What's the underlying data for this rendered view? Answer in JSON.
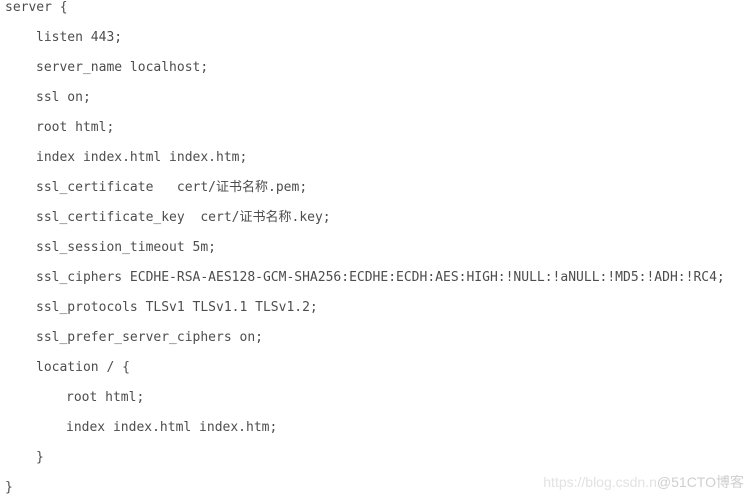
{
  "code_block": {
    "lines": [
      {
        "indent": 0,
        "text": "server {"
      },
      {
        "indent": 1,
        "text": "listen 443;"
      },
      {
        "indent": 1,
        "text": "server_name localhost;"
      },
      {
        "indent": 1,
        "text": "ssl on;"
      },
      {
        "indent": 1,
        "text": "root html;"
      },
      {
        "indent": 1,
        "text": "index index.html index.htm;"
      },
      {
        "indent": 1,
        "text": "ssl_certificate   cert/证书名称.pem;"
      },
      {
        "indent": 1,
        "text": "ssl_certificate_key  cert/证书名称.key;"
      },
      {
        "indent": 1,
        "text": "ssl_session_timeout 5m;"
      },
      {
        "indent": 1,
        "text": "ssl_ciphers ECDHE-RSA-AES128-GCM-SHA256:ECDHE:ECDH:AES:HIGH:!NULL:!aNULL:!MD5:!ADH:!RC4;"
      },
      {
        "indent": 1,
        "text": "ssl_protocols TLSv1 TLSv1.1 TLSv1.2;"
      },
      {
        "indent": 1,
        "text": "ssl_prefer_server_ciphers on;"
      },
      {
        "indent": 1,
        "text": "location / {"
      },
      {
        "indent": 2,
        "text": "root html;"
      },
      {
        "indent": 2,
        "text": "index index.html index.htm;"
      },
      {
        "indent": 1,
        "text": "}"
      },
      {
        "indent": 0,
        "text": "}"
      }
    ]
  },
  "watermark": {
    "url": "https://blog.csdn.n",
    "brand": "@51CTO博客"
  }
}
